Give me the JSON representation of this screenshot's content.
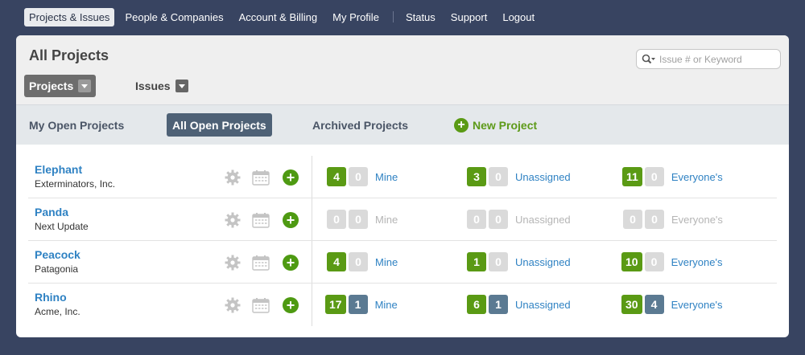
{
  "topnav": {
    "left": [
      "Projects & Issues",
      "People & Companies",
      "Account & Billing",
      "My Profile"
    ],
    "right": [
      "Status",
      "Support",
      "Logout"
    ]
  },
  "header": {
    "title": "All Projects",
    "search_placeholder": "Issue # or Keyword",
    "selectors": [
      "Projects",
      "Issues"
    ]
  },
  "subnav": {
    "tabs": [
      "My Open Projects",
      "All Open Projects",
      "Archived Projects"
    ],
    "active_tab": "All Open Projects",
    "new_project": "New Project"
  },
  "stat_labels": [
    "Mine",
    "Unassigned",
    "Everyone's"
  ],
  "projects": [
    {
      "name": "Elephant",
      "company": "Exterminators, Inc.",
      "mine": [
        "4",
        "0"
      ],
      "unassigned": [
        "3",
        "0"
      ],
      "everyone": [
        "11",
        "0"
      ]
    },
    {
      "name": "Panda",
      "company": "Next Update",
      "mine": [
        "0",
        "0"
      ],
      "unassigned": [
        "0",
        "0"
      ],
      "everyone": [
        "0",
        "0"
      ]
    },
    {
      "name": "Peacock",
      "company": "Patagonia",
      "mine": [
        "4",
        "0"
      ],
      "unassigned": [
        "1",
        "0"
      ],
      "everyone": [
        "10",
        "0"
      ]
    },
    {
      "name": "Rhino",
      "company": "Acme, Inc.",
      "mine": [
        "17",
        "1"
      ],
      "unassigned": [
        "6",
        "1"
      ],
      "everyone": [
        "30",
        "4"
      ]
    }
  ],
  "colors": {
    "green": "#5a9a14",
    "blue": "#5b7a92",
    "gray": "#dadada",
    "link": "#2f82c3",
    "background": "#384461"
  }
}
